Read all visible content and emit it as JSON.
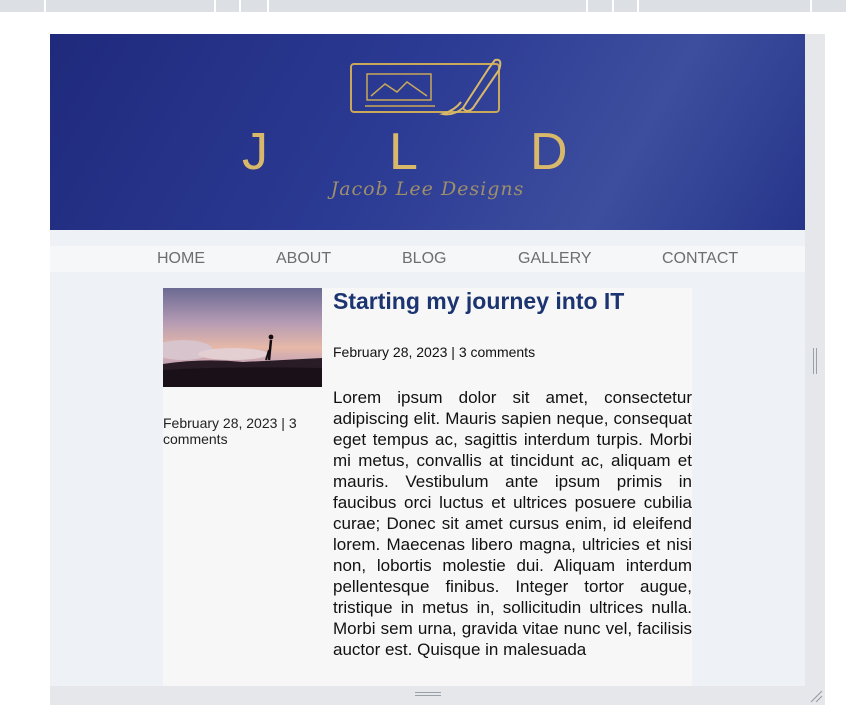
{
  "brand": {
    "letters": [
      "J",
      "L",
      "D"
    ],
    "script": "Jacob Lee Designs"
  },
  "nav": {
    "items": [
      "HOME",
      "ABOUT",
      "BLOG",
      "GALLERY",
      "CONTACT"
    ]
  },
  "post": {
    "title": "Starting my journey into IT",
    "meta": "February 28, 2023 | 3 comments",
    "side_meta": "February 28, 2023 | 3 comments",
    "body": "Lorem ipsum dolor sit amet, consectetur adipiscing elit. Mauris sapien neque, consequat eget tempus ac, sagittis interdum turpis. Morbi mi metus, convallis at tincidunt ac, aliquam et mauris. Vestibulum ante ipsum primis in faucibus orci luctus et ultrices posuere cubilia curae; Donec sit amet cursus enim, id eleifend lorem. Maecenas libero magna, ultricies et nisi non, lobortis molestie dui. Aliquam interdum pellentesque finibus. Integer tortor augue, tristique in metus in, sollicitudin ultrices nulla. Morbi sem urna, gravida vitae nunc vel, facilisis auctor est. Quisque in malesuada"
  },
  "colors": {
    "banner": "#2b3a93",
    "gold": "#d8b86a",
    "title": "#1c3570",
    "nav_text": "#6e6e6e"
  },
  "icons": [
    "logo-frame-brush-icon",
    "resize-grip-icon"
  ]
}
